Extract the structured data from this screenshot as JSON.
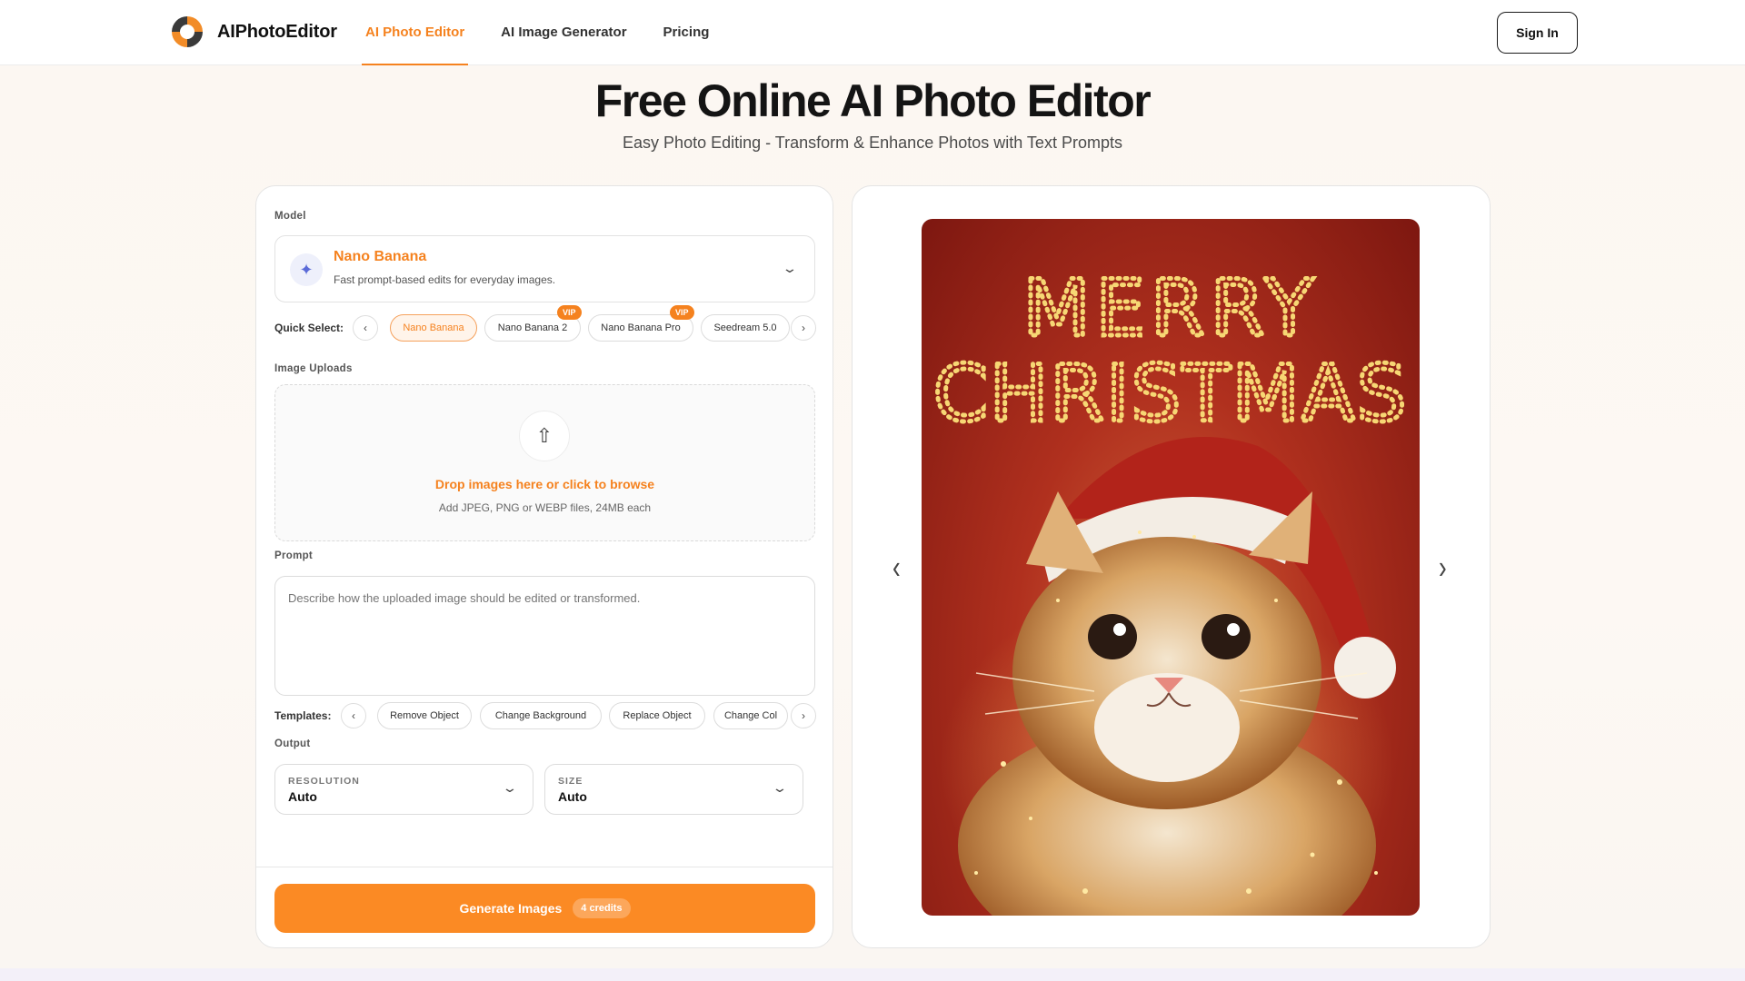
{
  "app": {
    "name": "AIPhotoEditor"
  },
  "nav": {
    "items": [
      {
        "label": "AI Photo Editor",
        "active": true
      },
      {
        "label": "AI Image Generator",
        "active": false
      },
      {
        "label": "Pricing",
        "active": false
      }
    ],
    "signin_label": "Sign In"
  },
  "hero": {
    "title": "Free Online AI Photo Editor",
    "subtitle": "Easy Photo Editing - Transform & Enhance Photos with Text Prompts"
  },
  "form": {
    "model_label": "Model",
    "model": {
      "name": "Nano Banana",
      "description": "Fast prompt-based edits for everyday images.",
      "icon": "sparkles-icon"
    },
    "quick_select_label": "Quick Select:",
    "quick_select": [
      {
        "label": "Nano Banana",
        "active": true,
        "vip": ""
      },
      {
        "label": "Nano Banana 2",
        "active": false,
        "vip": "VIP"
      },
      {
        "label": "Nano Banana Pro",
        "active": false,
        "vip": "VIP"
      },
      {
        "label": "Seedream 5.0",
        "active": false,
        "vip": ""
      }
    ],
    "uploads_label": "Image Uploads",
    "upload": {
      "cta": "Drop images here or click to browse",
      "hint": "Add JPEG, PNG or WEBP files, 24MB each"
    },
    "prompt_label": "Prompt",
    "prompt_placeholder": "Describe how the uploaded image should be edited or transformed.",
    "templates_label": "Templates:",
    "templates": [
      "Remove Object",
      "Change Background",
      "Replace Object",
      "Change Col"
    ],
    "output_label": "Output",
    "resolution": {
      "caption": "RESOLUTION",
      "value": "Auto"
    },
    "size": {
      "caption": "SIZE",
      "value": "Auto"
    },
    "generate_label": "Generate Images",
    "credits_label": "4 credits"
  },
  "preview": {
    "line1": "MERRY",
    "line2": "CHRISTMAS",
    "colors": {
      "background": "#b0301e",
      "lettering": "#f7d774",
      "accent": "#f5821f"
    }
  }
}
